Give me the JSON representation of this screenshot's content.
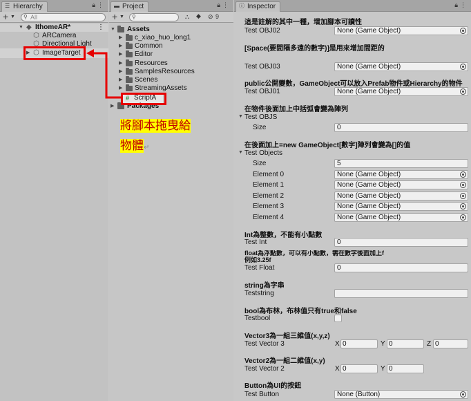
{
  "hierarchy": {
    "tab": "Hierarchy",
    "search_placeholder": "All",
    "scene": "IthomeAR*",
    "items": [
      {
        "label": "ARCamera"
      },
      {
        "label": "Directional Light"
      },
      {
        "label": "ImageTarget"
      }
    ]
  },
  "project": {
    "tab": "Project",
    "hidden_count": "9",
    "root": "Assets",
    "folders": [
      "c_xiao_huo_long1",
      "Common",
      "Editor",
      "Resources",
      "SamplesResources",
      "Scenes",
      "StreamingAssets"
    ],
    "script": "ScriptA",
    "packages": "Packages"
  },
  "inspector": {
    "tab": "Inspector",
    "none_obj": "None (Game Object)",
    "none_btn": "None (Button)",
    "h1": "這是註解的其中一種，增加腳本可讀性",
    "obj02": "Test OBJ02",
    "h2": "[Space(要間隔多遠的數字)]是用來增加間距的",
    "obj03": "Test OBJ03",
    "h3": "public公開變數，GameObject可以放入Prefab物件或Hierarchy的物件",
    "obj01": "Test OBJ01",
    "h4": "在物件後面加上中括弧會變為陣列",
    "objs": "Test OBJS",
    "size_label": "Size",
    "objs_size": "0",
    "h5": "在後面加上=new GameObject[數字]陣列會變為[]的值",
    "objects": "Test Objects",
    "objects_size": "5",
    "elements": [
      "Element 0",
      "Element 1",
      "Element 2",
      "Element 3",
      "Element 4"
    ],
    "h6": "Int為整數，不能有小點數",
    "int_label": "Test Int",
    "int_val": "0",
    "h7a": "float為浮點數，可以有小點數，需在數字後面加上f",
    "h7b": "例如3.25f",
    "float_label": "Test Float",
    "float_val": "0",
    "h8": "string為字串",
    "string_label": "Teststring",
    "string_val": "",
    "h9": "bool為布林，布林值只有true和false",
    "bool_label": "Testbool",
    "h10": "Vector3為一組三維值(x,y,z)",
    "v3_label": "Test Vector 3",
    "v3": {
      "x": "0",
      "y": "0",
      "z": "0"
    },
    "h11": "Vector2為一組二維值(x,y)",
    "v2_label": "Test Vector 2",
    "v2": {
      "x": "0",
      "y": "0"
    },
    "h12": "Button為UI的按鈕",
    "btn_label": "Test Button",
    "axis": {
      "x": "X",
      "y": "Y",
      "z": "Z"
    }
  },
  "annotation": {
    "line1": "將腳本拖曳給",
    "line2": "物體"
  }
}
